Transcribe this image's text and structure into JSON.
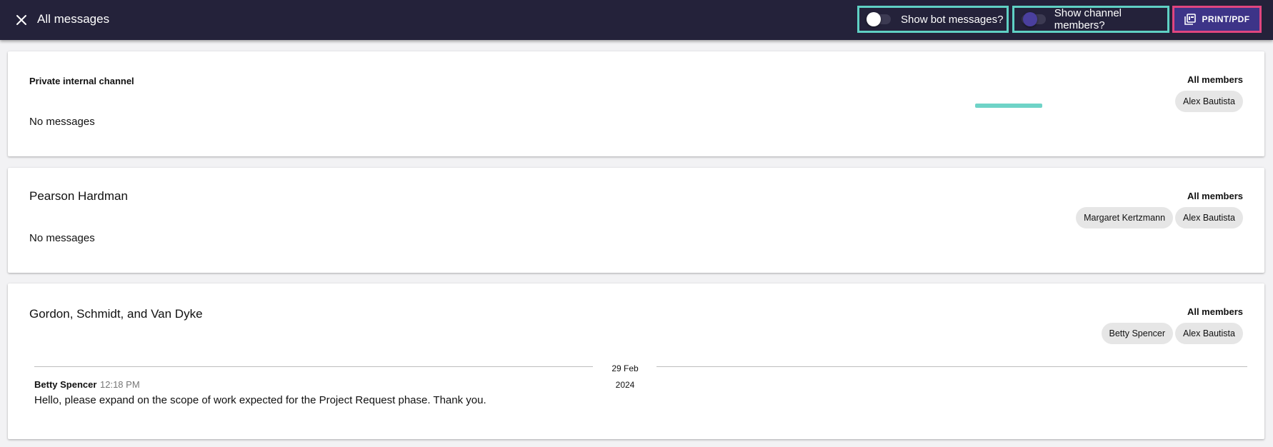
{
  "header": {
    "title": "All messages",
    "bot_toggle_label": "Show bot messages?",
    "members_toggle_label": "Show channel members?",
    "print_label": "PRINT/PDF"
  },
  "channels": [
    {
      "title": "Private internal channel",
      "members_heading": "All members",
      "members": [
        "Alex Bautista"
      ],
      "empty_text": "No messages"
    },
    {
      "title": "Pearson Hardman",
      "members_heading": "All members",
      "members": [
        "Margaret Kertzmann",
        "Alex Bautista"
      ],
      "empty_text": "No messages"
    },
    {
      "title": "Gordon, Schmidt, and Van Dyke",
      "members_heading": "All members",
      "members": [
        "Betty Spencer",
        "Alex Bautista"
      ],
      "date_day": "29 Feb",
      "date_year": "2024",
      "message": {
        "author": "Betty Spencer",
        "time": "12:18 PM",
        "text": "Hello, please expand on the scope of work expected for the Project Request phase. Thank you."
      }
    }
  ],
  "colors": {
    "topbar": "#24223a",
    "highlight_teal": "#5fd0c4",
    "highlight_pink": "#e0457f",
    "primary": "#3d3488"
  }
}
